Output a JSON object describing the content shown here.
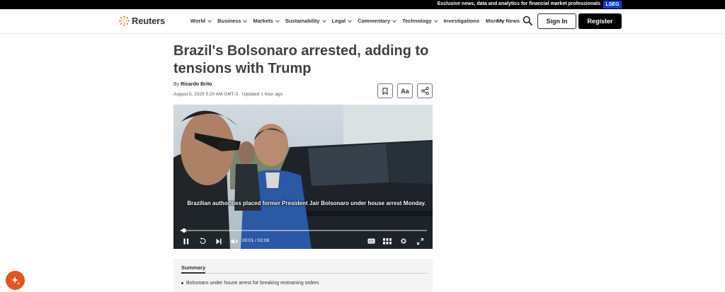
{
  "topbar": {
    "promo": "Exclusive news, data and analytics for financial market professionals",
    "badge": "LSEG"
  },
  "nav": {
    "logo": "Reuters",
    "menu": [
      {
        "label": "World",
        "dropdown": true
      },
      {
        "label": "Business",
        "dropdown": true
      },
      {
        "label": "Markets",
        "dropdown": true
      },
      {
        "label": "Sustainability",
        "dropdown": true
      },
      {
        "label": "Legal",
        "dropdown": true
      },
      {
        "label": "Commentary",
        "dropdown": true
      },
      {
        "label": "Technology",
        "dropdown": true
      },
      {
        "label": "Investigations",
        "dropdown": false
      },
      {
        "label": "More",
        "dropdown": true
      }
    ],
    "my_news": "My News",
    "sign_in": "Sign In",
    "register": "Register"
  },
  "article": {
    "headline": "Brazil's Bolsonaro arrested, adding to tensions with Trump",
    "by": "By",
    "author": "Ricardo Brito",
    "dateline": "August 5, 2025 5:20 AM GMT-3 · Updated 1 hour ago",
    "tools": {
      "bookmark_icon": "bookmark-icon",
      "text_size": "Aa",
      "share_icon": "share-icon"
    }
  },
  "video": {
    "caption": "Brazilian authorities placed former President Jair Bolsonaro under house arrest Monday.",
    "current_time": "00:01",
    "separator": "/",
    "duration": "02:08",
    "progress_fraction": 0.01,
    "cc_label": "CC"
  },
  "summary": {
    "title": "Summary",
    "items": [
      "Bolsonaro under house arrest for breaking restraining orders"
    ]
  },
  "colors": {
    "brand_orange": "#fa6400",
    "lseg_blue": "#0a3dd1",
    "ai_button": "#e2561c"
  }
}
